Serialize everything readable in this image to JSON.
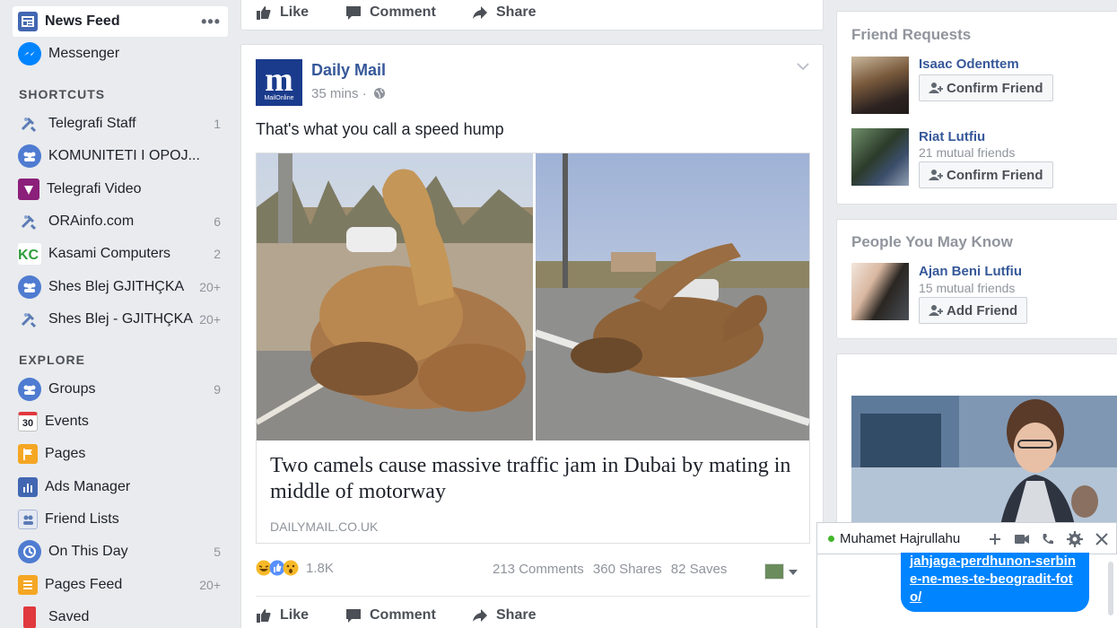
{
  "sidebar": {
    "news_feed": "News Feed",
    "news_feed_more": "•••",
    "messenger": "Messenger",
    "shortcuts_heading": "SHORTCUTS",
    "shortcuts": [
      {
        "label": "Telegrafi Staff",
        "count": "1"
      },
      {
        "label": "KOMUNITETI I OPOJ...",
        "count": ""
      },
      {
        "label": "Telegrafi Video",
        "count": ""
      },
      {
        "label": "ORAinfo.com",
        "count": "6"
      },
      {
        "label": "Kasami Computers",
        "count": "2"
      },
      {
        "label": "Shes Blej GJITHÇKA",
        "count": "20+"
      },
      {
        "label": "Shes Blej - GJITHÇKA",
        "count": "20+"
      }
    ],
    "explore_heading": "EXPLORE",
    "explore": [
      {
        "label": "Groups",
        "count": "9"
      },
      {
        "label": "Events",
        "count": "",
        "icon_text": "30"
      },
      {
        "label": "Pages",
        "count": ""
      },
      {
        "label": "Ads Manager",
        "count": ""
      },
      {
        "label": "Friend Lists",
        "count": ""
      },
      {
        "label": "On This Day",
        "count": "5"
      },
      {
        "label": "Pages Feed",
        "count": "20+"
      },
      {
        "label": "Saved",
        "count": ""
      }
    ]
  },
  "top_actions": {
    "like": "Like",
    "comment": "Comment",
    "share": "Share"
  },
  "post": {
    "page_name": "Daily Mail",
    "logo_letter": "m",
    "logo_caption": "MailOnline",
    "time": "35 mins ·",
    "text": "That's what you call a speed hump",
    "link_title": "Two camels cause massive traffic jam in Dubai by mating in middle of motorway",
    "link_domain": "DAILYMAIL.CO.UK",
    "reactions": "1.8K",
    "comments": "213 Comments",
    "shares": "360 Shares",
    "saves": "82 Saves",
    "actions": {
      "like": "Like",
      "comment": "Comment",
      "share": "Share"
    }
  },
  "friend_requests": {
    "heading": "Friend Requests",
    "items": [
      {
        "name": "Isaac Odenttem",
        "mutual": "",
        "button": "Confirm Friend"
      },
      {
        "name": "Riat Lutfiu",
        "mutual": "21 mutual friends",
        "button": "Confirm Friend"
      }
    ]
  },
  "people_you_may_know": {
    "heading": "People You May Know",
    "items": [
      {
        "name": "Ajan Beni Lutfiu",
        "mutual": "15 mutual friends",
        "button": "Add Friend"
      }
    ]
  },
  "chat": {
    "contact": "Muhamet Hajrullahu",
    "message_link": "jahjaga-perdhunon-serbine-ne-mes-te-beogradit-foto/",
    "online_color": "#42b72a"
  },
  "colors": {
    "link": "#365899",
    "fb_blue": "#4267b2",
    "messenger_bubble": "#0084ff",
    "background": "#e9ebee"
  }
}
